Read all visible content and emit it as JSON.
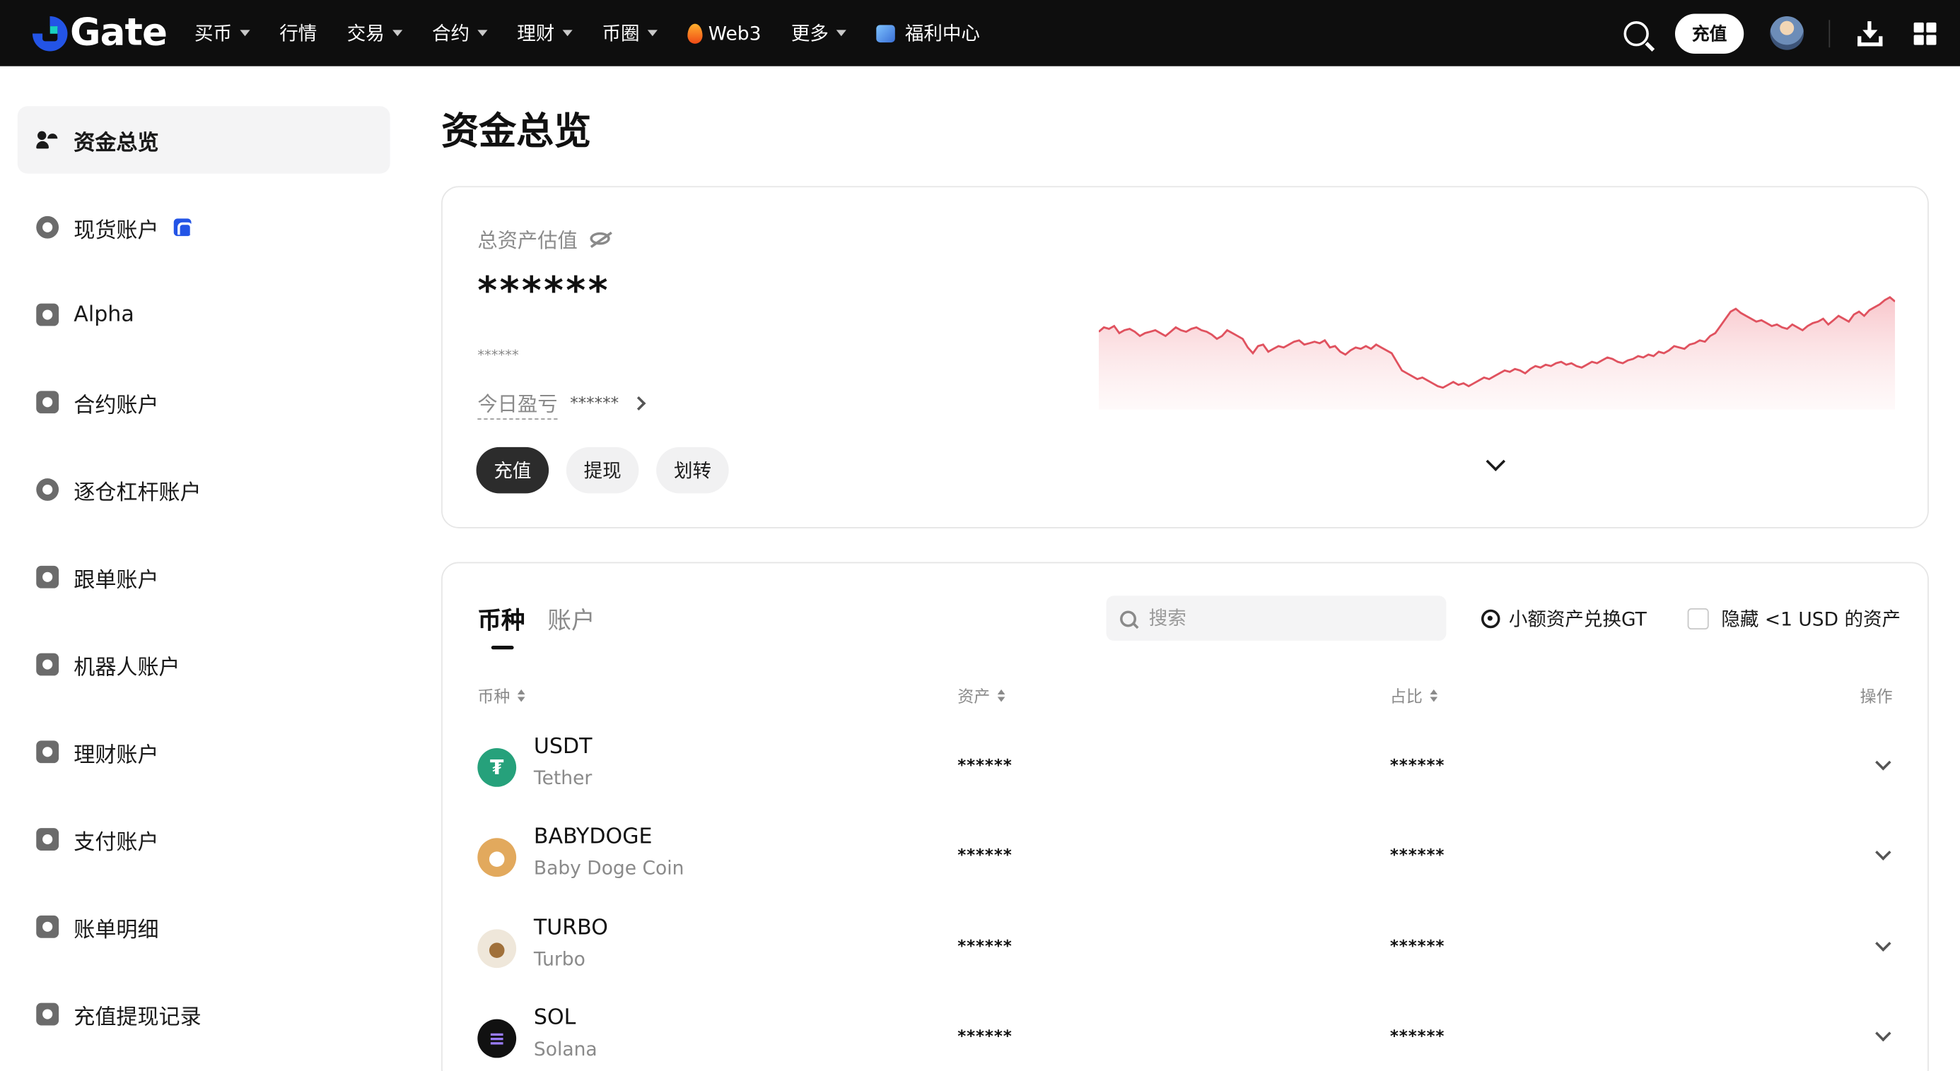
{
  "header": {
    "logo_text": "Gate",
    "nav": [
      {
        "label": "买币",
        "caret": true
      },
      {
        "label": "行情",
        "caret": false
      },
      {
        "label": "交易",
        "caret": true
      },
      {
        "label": "合约",
        "caret": true
      },
      {
        "label": "理财",
        "caret": true
      },
      {
        "label": "币圈",
        "caret": true
      },
      {
        "label": "Web3",
        "caret": false,
        "icon": "fire-icon"
      },
      {
        "label": "更多",
        "caret": true
      },
      {
        "label": "福利中心",
        "caret": false,
        "icon": "gift-box-icon"
      }
    ],
    "deposit_label": "充值"
  },
  "sidebar": {
    "items": [
      {
        "label": "资金总览",
        "icon": "assets-user-icon",
        "active": true
      },
      {
        "label": "现货账户",
        "icon": "spot-coin-icon",
        "badge": "spot-home-icon"
      },
      {
        "label": "Alpha",
        "icon": "alpha-icon"
      },
      {
        "label": "合约账户",
        "icon": "futures-icon"
      },
      {
        "label": "逐仓杠杆账户",
        "icon": "margin-icon"
      },
      {
        "label": "跟单账户",
        "icon": "copy-trade-icon"
      },
      {
        "label": "机器人账户",
        "icon": "robot-icon"
      },
      {
        "label": "理财账户",
        "icon": "earn-icon"
      },
      {
        "label": "支付账户",
        "icon": "card-icon"
      },
      {
        "label": "账单明细",
        "icon": "bill-icon"
      },
      {
        "label": "充值提现记录",
        "icon": "records-icon"
      }
    ]
  },
  "main": {
    "title": "资金总览",
    "overview": {
      "total_label": "总资产估值",
      "balance": "******",
      "balance_sub": "******",
      "pnl_label": "今日盈亏",
      "pnl_value": "******",
      "buttons": [
        "充值",
        "提现",
        "划转"
      ]
    },
    "assets": {
      "tabs": [
        "币种",
        "账户"
      ],
      "search_placeholder": "搜索",
      "convert_label": "小额资产兑换GT",
      "hide_small_label": "隐藏 <1 USD 的资产",
      "columns": [
        "币种",
        "资产",
        "占比",
        "操作"
      ],
      "rows": [
        {
          "symbol": "USDT",
          "name": "Tether",
          "amount": "******",
          "ratio": "******",
          "logo_color": "#26a17b",
          "logo_char": "₮"
        },
        {
          "symbol": "BABYDOGE",
          "name": "Baby Doge Coin",
          "amount": "******",
          "ratio": "******",
          "logo_color": "#e2a95d",
          "logo_char": "●"
        },
        {
          "symbol": "TURBO",
          "name": "Turbo",
          "amount": "******",
          "ratio": "******",
          "logo_color": "#efe7da",
          "logo_char": "●"
        },
        {
          "symbol": "SOL",
          "name": "Solana",
          "amount": "******",
          "ratio": "******",
          "logo_color": "#111111",
          "logo_char": "≡"
        }
      ]
    }
  },
  "colors": {
    "topbar_bg": "#0e0e0e",
    "brand_blue": "#2354e6",
    "chart_line": "#e0525f",
    "chart_fill": "#fde6e8"
  },
  "chart_data": {
    "type": "area",
    "series": [
      {
        "values": [
          41,
          44,
          43,
          45,
          40,
          42,
          43,
          41,
          38,
          40,
          41,
          42,
          40,
          38,
          41,
          44,
          42,
          41,
          43,
          44,
          42,
          41,
          39,
          36,
          38,
          42,
          40,
          38,
          36,
          30,
          26,
          31,
          32,
          27,
          29,
          31,
          30,
          32,
          34,
          35,
          32,
          33,
          34,
          33,
          35,
          30,
          31,
          27,
          25,
          28,
          30,
          29,
          31,
          29,
          32,
          30,
          28,
          26,
          20,
          14,
          12,
          10,
          8,
          9,
          7,
          5,
          3,
          2,
          4,
          6,
          4,
          5,
          3,
          5,
          7,
          9,
          8,
          10,
          12,
          14,
          13,
          15,
          14,
          12,
          15,
          17,
          16,
          18,
          17,
          19,
          20,
          18,
          19,
          17,
          16,
          18,
          20,
          19,
          21,
          23,
          22,
          20,
          19,
          21,
          22,
          24,
          23,
          25,
          24,
          27,
          26,
          28,
          31,
          30,
          29,
          32,
          33,
          35,
          34,
          38,
          40,
          45,
          50,
          55,
          57,
          54,
          52,
          50,
          48,
          49,
          47,
          45,
          46,
          44,
          43,
          46,
          44,
          42,
          45,
          47,
          48,
          50,
          46,
          49,
          52,
          50,
          48,
          53,
          55,
          52,
          56,
          58,
          60,
          63,
          65,
          62
        ]
      }
    ]
  }
}
